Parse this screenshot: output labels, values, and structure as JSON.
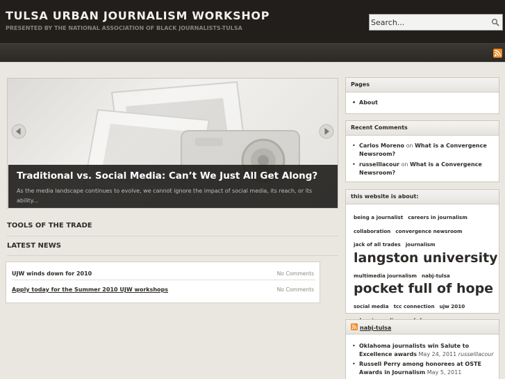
{
  "header": {
    "title": "TULSA URBAN JOURNALISM WORKSHOP",
    "tagline": "PRESENTED BY THE NATIONAL ASSOCIATION OF BLACK JOURNALISTS-TULSA"
  },
  "search": {
    "placeholder": "Search...",
    "value": "Search..."
  },
  "slider": {
    "title": "Traditional vs. Social Media: Can’t We Just All Get Along?",
    "excerpt": "As the media landscape continues to evolve, we cannot ignore the impact of social media, its reach, or its ability..."
  },
  "sections": {
    "tools": "TOOLS OF THE TRADE",
    "latest": "LATEST NEWS"
  },
  "news": [
    {
      "title": "UJW winds down for 2010",
      "comments": "No Comments"
    },
    {
      "title": "Apply today for the Summer 2010 UJW workshops",
      "comments": "No Comments"
    }
  ],
  "sidebar": {
    "pages": {
      "heading": "Pages",
      "items": [
        "About"
      ]
    },
    "recent_comments": {
      "heading": "Recent Comments",
      "items": [
        {
          "author": "Carlos Moreno",
          "on": "on",
          "post": "What is a Convergence Newsroom?"
        },
        {
          "author": "russelllacour",
          "on": "on",
          "post": "What is a Convergence Newsroom?"
        }
      ]
    },
    "tags": {
      "heading": "this website is about:",
      "items": [
        "being a journalist",
        "careers in journalism",
        "collaboration",
        "convergence newsroom",
        "jack of all trades",
        "journalism",
        "langston university",
        "multimedia journalism",
        "nabj-tulsa",
        "pocket full of hope",
        "social media",
        "tcc connection",
        "ujw 2010",
        "urban journalism workshop"
      ]
    },
    "feed": {
      "heading": "nabj-tulsa",
      "items": [
        {
          "title": "Oklahoma journalists win Salute to Excellence awards",
          "date": "May 24, 2011",
          "author": "russelllacour"
        },
        {
          "title": "Russell Perry among honorees at OSTE Awards in Journalism",
          "date": "May 5, 2011",
          "author": ""
        }
      ]
    }
  },
  "colors": {
    "header_bg": "#211e1b",
    "nav_bg": "#34312d",
    "page_bg": "#eae7e0",
    "rss_orange": "#f08a24"
  }
}
